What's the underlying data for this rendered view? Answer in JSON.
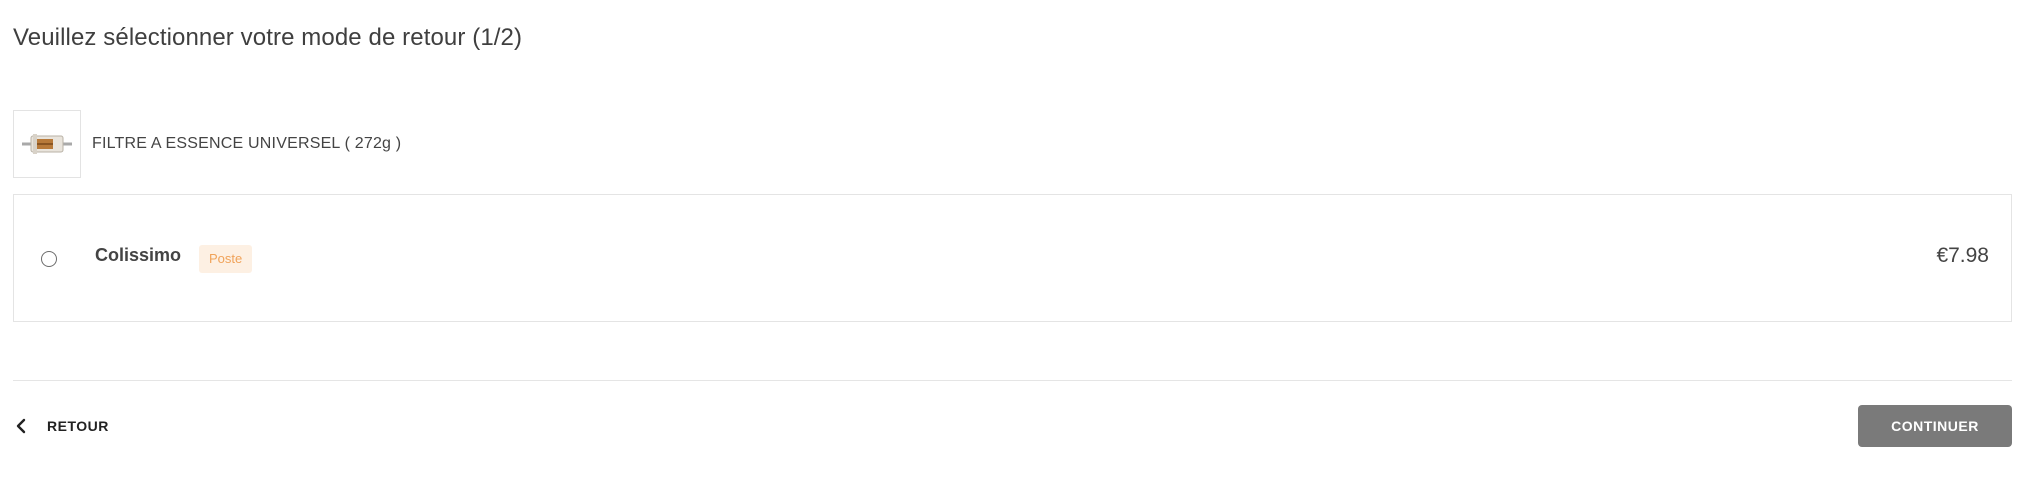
{
  "header": {
    "title": "Veuillez sélectionner votre mode de retour (1/2)"
  },
  "product": {
    "name": "FILTRE A ESSENCE UNIVERSEL  ( 272g )",
    "image_icon": "fuel-filter-icon"
  },
  "shipping_options": [
    {
      "carrier": "Colissimo",
      "badge": "Poste",
      "price": "€7.98",
      "selected": false
    }
  ],
  "footer": {
    "back_label": "RETOUR",
    "continue_label": "CONTINUER"
  },
  "colors": {
    "badge_text": "#f0a35a",
    "badge_bg": "#fdf0e3",
    "continue_bg": "#7a7a7a"
  }
}
